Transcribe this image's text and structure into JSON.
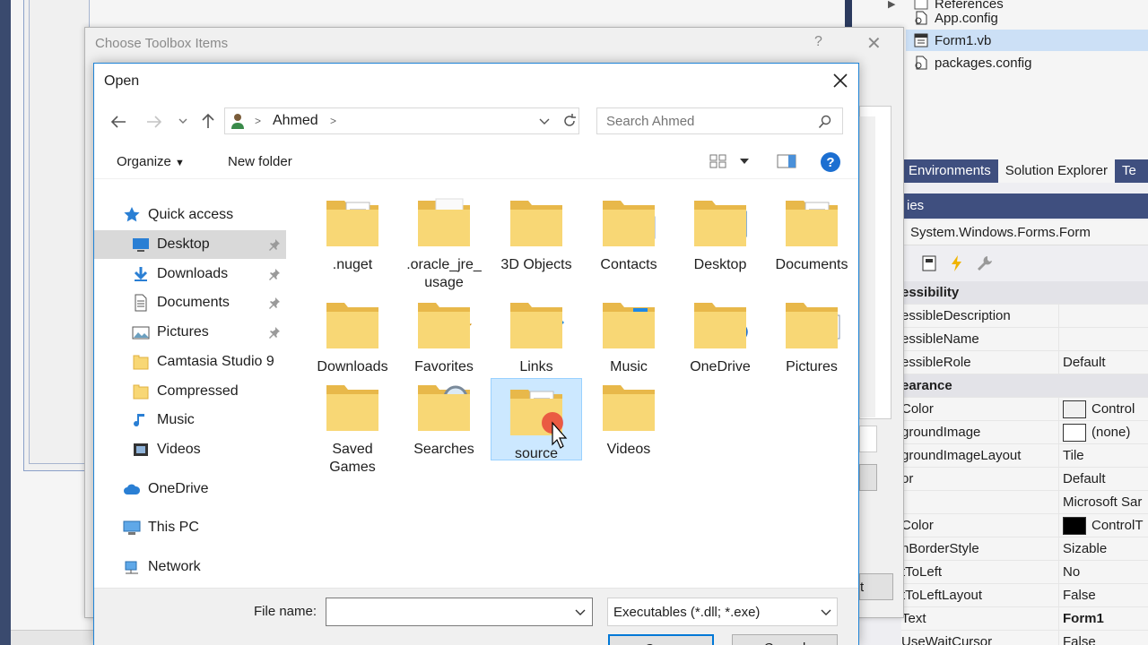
{
  "solution_explorer": {
    "items": [
      {
        "label": "References",
        "icon": "references-icon"
      },
      {
        "label": "App.config",
        "icon": "config-file-icon"
      },
      {
        "label": "Form1.vb",
        "icon": "form-file-icon",
        "selected": true
      },
      {
        "label": "packages.config",
        "icon": "config-file-icon"
      }
    ],
    "tabs": [
      "Environments",
      "Solution Explorer",
      "Te"
    ]
  },
  "properties": {
    "header": "ies",
    "object": "System.Windows.Forms.Form",
    "rows": [
      {
        "name": "essibility",
        "value": "",
        "category": true
      },
      {
        "name": "essibleDescription",
        "value": ""
      },
      {
        "name": "essibleName",
        "value": ""
      },
      {
        "name": "essibleRole",
        "value": "Default"
      },
      {
        "name": "earance",
        "value": "",
        "category": true
      },
      {
        "name": "Color",
        "value": "Control",
        "swatch": "#f0f0f0"
      },
      {
        "name": "groundImage",
        "value": "(none)",
        "swatch": "#ffffff"
      },
      {
        "name": "groundImageLayout",
        "value": "Tile"
      },
      {
        "name": "or",
        "value": "Default"
      },
      {
        "name": "",
        "value": "Microsoft Sar"
      },
      {
        "name": "Color",
        "value": "ControlT",
        "swatch": "#000000"
      },
      {
        "name": "nBorderStyle",
        "value": "Sizable"
      },
      {
        "name": "tToLeft",
        "value": "No"
      },
      {
        "name": "tToLeftLayout",
        "value": "False"
      },
      {
        "name": "Text",
        "value": "Form1",
        "bold": true
      },
      {
        "name": "UseWaitCursor",
        "value": "False"
      }
    ]
  },
  "toolbox_dialog": {
    "title": "Choose Toolbox Items",
    "help": "?",
    "button_fragment": "t"
  },
  "open_dialog": {
    "title": "Open",
    "address": {
      "segment": "Ahmed"
    },
    "search_placeholder": "Search Ahmed",
    "toolbar": {
      "organize": "Organize",
      "new_folder": "New folder"
    },
    "nav": [
      {
        "label": "Quick access",
        "icon": "star-icon",
        "indent": 0
      },
      {
        "label": "Desktop",
        "icon": "desktop-icon",
        "indent": 1,
        "pinned": true,
        "selected": true
      },
      {
        "label": "Downloads",
        "icon": "download-arrow-icon",
        "indent": 1,
        "pinned": true
      },
      {
        "label": "Documents",
        "icon": "documents-icon",
        "indent": 1,
        "pinned": true
      },
      {
        "label": "Pictures",
        "icon": "pictures-icon",
        "indent": 1,
        "pinned": true
      },
      {
        "label": "Camtasia Studio 9",
        "icon": "folder-icon",
        "indent": 1
      },
      {
        "label": "Compressed",
        "icon": "folder-icon",
        "indent": 1
      },
      {
        "label": "Music",
        "icon": "music-note-icon",
        "indent": 1
      },
      {
        "label": "Videos",
        "icon": "video-icon",
        "indent": 1
      },
      {
        "label": "OneDrive",
        "icon": "onedrive-cloud-icon",
        "indent": 0
      },
      {
        "label": "This PC",
        "icon": "computer-icon",
        "indent": 0
      },
      {
        "label": "Network",
        "icon": "network-icon",
        "indent": 0
      }
    ],
    "folders": [
      {
        "label": ".nuget",
        "overlay": "document"
      },
      {
        "label": ".oracle_jre_usage",
        "label_line2": "usage",
        "label_line1": ".oracle_jre_",
        "overlay": "blank"
      },
      {
        "label": "3D Objects",
        "overlay": "cube"
      },
      {
        "label": "Contacts",
        "overlay": "contact"
      },
      {
        "label": "Desktop",
        "overlay": "screen"
      },
      {
        "label": "Documents",
        "overlay": "document"
      },
      {
        "label": "Downloads",
        "overlay": "download"
      },
      {
        "label": "Favorites",
        "overlay": "star"
      },
      {
        "label": "Links",
        "overlay": "link"
      },
      {
        "label": "Music",
        "overlay": "note"
      },
      {
        "label": "OneDrive",
        "overlay": "cloud"
      },
      {
        "label": "Pictures",
        "overlay": "picture"
      },
      {
        "label": "Saved Games",
        "label_line1": "Saved",
        "label_line2": "Games",
        "overlay": "chess"
      },
      {
        "label": "Searches",
        "overlay": "magnifier"
      },
      {
        "label": "source",
        "overlay": "document",
        "selected": true
      },
      {
        "label": "Videos",
        "overlay": "film"
      }
    ],
    "file_name_label": "File name:",
    "file_name_value": "",
    "file_type": "Executables (*.dll; *.exe)",
    "open_button": "Open",
    "cancel_button": "Cancel"
  },
  "colors": {
    "folder_yellow": "#f8d775",
    "folder_dark": "#e8b84a",
    "accent_blue": "#0078d7",
    "vs_blue": "#3f4f7f",
    "selection": "#cce8ff"
  }
}
